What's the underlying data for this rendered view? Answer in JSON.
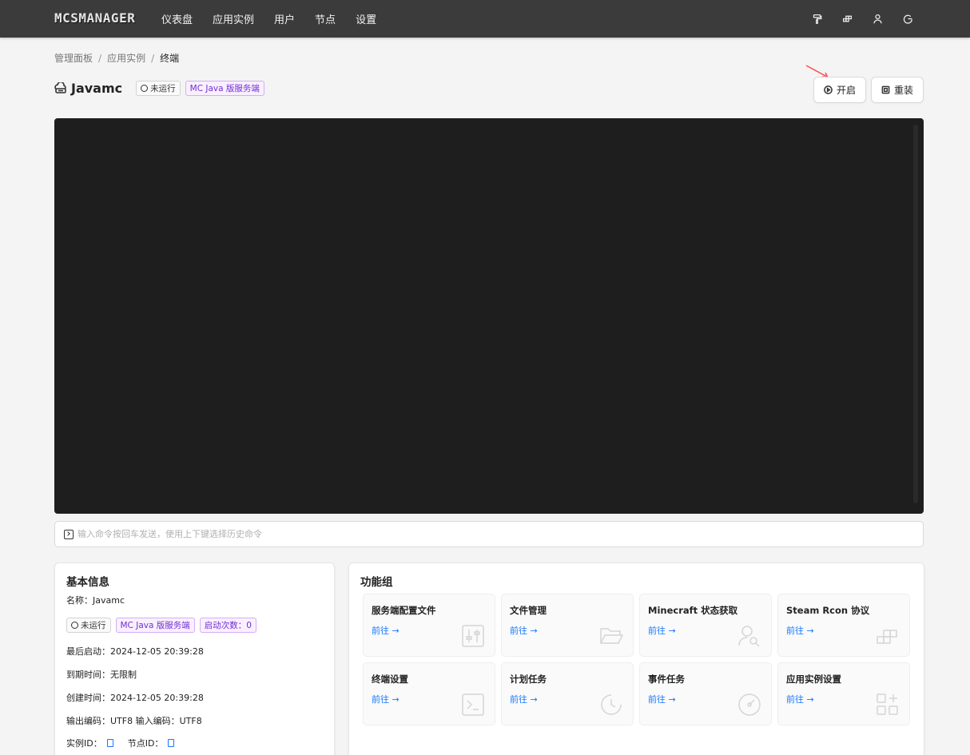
{
  "header": {
    "logo": "MCSMANAGER",
    "nav": [
      "仪表盘",
      "应用实例",
      "用户",
      "节点",
      "设置"
    ],
    "icons": [
      "paint-roller-icon",
      "blocks-icon",
      "user-icon",
      "logout-icon"
    ]
  },
  "breadcrumb": {
    "items": [
      "管理面板",
      "应用实例"
    ],
    "current": "终端"
  },
  "instance": {
    "name": "Javamc",
    "status": "未运行",
    "type": "MC Java 版服务端"
  },
  "actions": {
    "start": "开启",
    "reinstall": "重装"
  },
  "terminal": {
    "placeholder": "输入命令按回车发送，使用上下键选择历史命令"
  },
  "info": {
    "title": "基本信息",
    "name": "名称：Javamc",
    "status": "未运行",
    "type": "MC Java 版服务端",
    "start_count": "启动次数：0",
    "last_start": "最后启动：2024-12-05 20:39:28",
    "expire": "到期时间：无限制",
    "created": "创建时间：2024-12-05 20:39:28",
    "encoding": "输出编码：UTF8 输入编码：UTF8",
    "instance_id": "实例ID：",
    "node_id": "节点ID："
  },
  "functions": {
    "title": "功能组",
    "link": "前往 →",
    "items": [
      {
        "label": "服务端配置文件",
        "icon": "sliders-icon"
      },
      {
        "label": "文件管理",
        "icon": "folder-open-icon"
      },
      {
        "label": "Minecraft 状态获取",
        "icon": "user-search-icon"
      },
      {
        "label": "Steam Rcon 协议",
        "icon": "blocks-icon"
      },
      {
        "label": "终端设置",
        "icon": "terminal-icon"
      },
      {
        "label": "计划任务",
        "icon": "clock-icon"
      },
      {
        "label": "事件任务",
        "icon": "dashboard-icon"
      },
      {
        "label": "应用实例设置",
        "icon": "apps-icon"
      }
    ]
  },
  "colors": {
    "topbar": "#3b3b3b",
    "terminal": "#1e1e1e",
    "accent": "#1677ff",
    "purple": "#722ed1",
    "annotation_arrow": "#ff4d4f"
  }
}
